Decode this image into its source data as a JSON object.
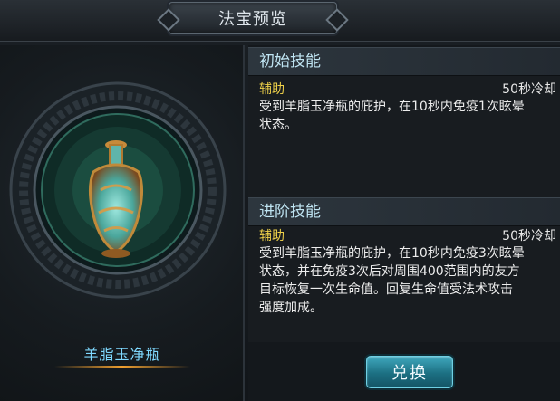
{
  "window": {
    "title": "法宝预览"
  },
  "item": {
    "name": "羊脂玉净瓶"
  },
  "skills": [
    {
      "header": "初始技能",
      "type": "辅助",
      "cooldown": "50秒冷却",
      "description_lines": [
        "受到羊脂玉净瓶的庇护，在10秒内免疫1次眩晕",
        "状态。"
      ]
    },
    {
      "header": "进阶技能",
      "type": "辅助",
      "cooldown": "50秒冷却",
      "description_lines": [
        "受到羊脂玉净瓶的庇护，在10秒内免疫3次眩晕",
        "状态，并在免疫3次后对周围400范围内的友方",
        "目标恢复一次生命值。回复生命值受法术攻击",
        "强度加成。"
      ]
    }
  ],
  "actions": {
    "exchange_label": "兑换"
  },
  "colors": {
    "accent": "#7fd9ff",
    "skill_type": "#f0d24a",
    "button": "#1c6f82"
  }
}
